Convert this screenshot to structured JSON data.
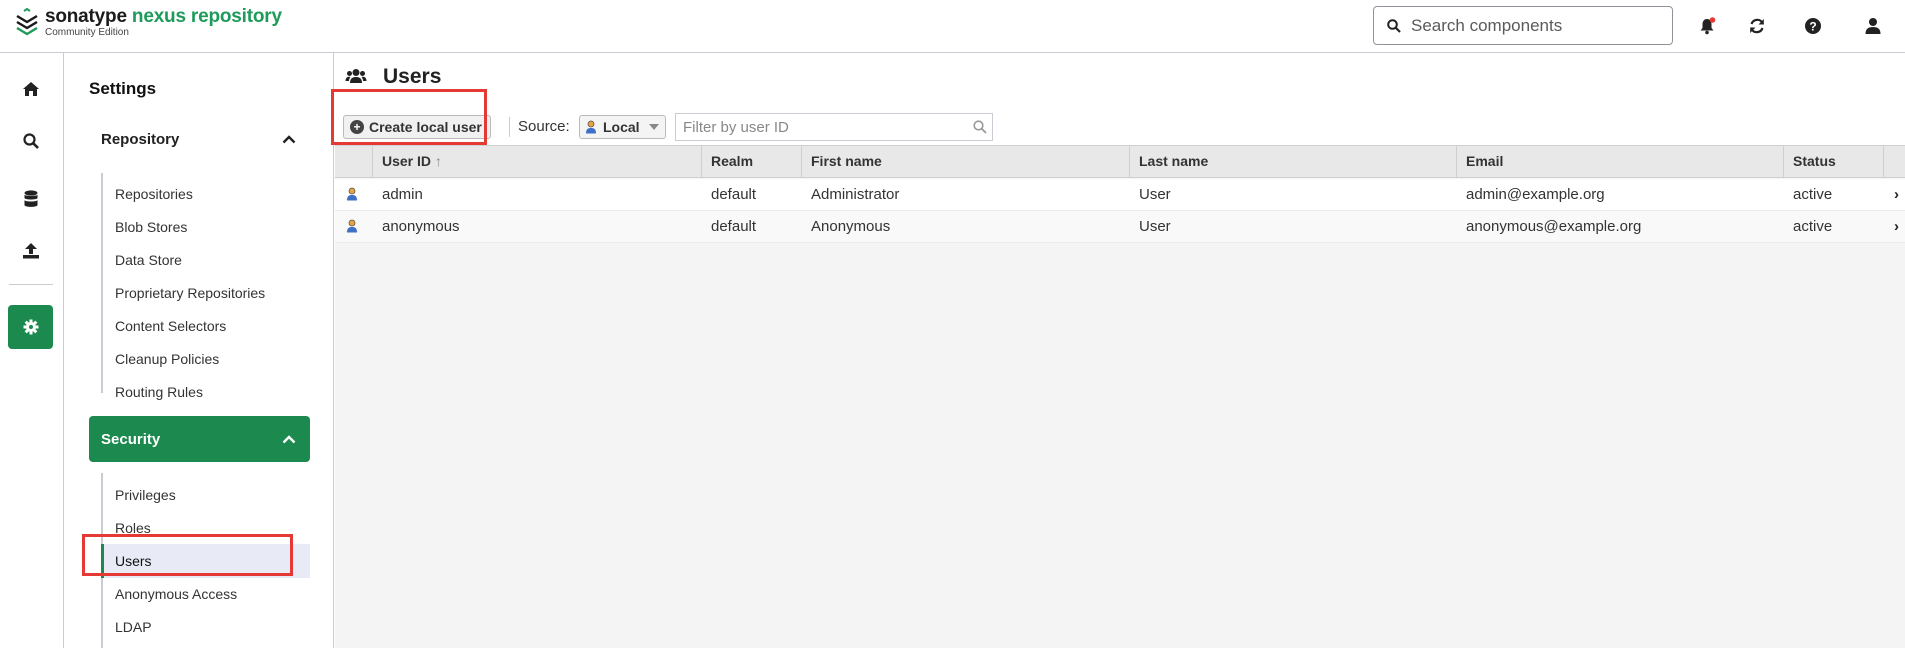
{
  "brand": {
    "name_part1": "sonatype",
    "name_part2": "nexus repository",
    "edition": "Community Edition"
  },
  "header": {
    "search_placeholder": "Search components"
  },
  "nav": {
    "title": "Settings",
    "repository_group": {
      "label": "Repository",
      "items": [
        "Repositories",
        "Blob Stores",
        "Data Store",
        "Proprietary Repositories",
        "Content Selectors",
        "Cleanup Policies",
        "Routing Rules"
      ]
    },
    "security_group": {
      "label": "Security",
      "items": [
        "Privileges",
        "Roles",
        "Users",
        "Anonymous Access",
        "LDAP"
      ]
    }
  },
  "page": {
    "title": "Users",
    "create_button": "Create local user",
    "source_label": "Source:",
    "source_value": "Local",
    "filter_placeholder": "Filter by user ID"
  },
  "table": {
    "columns": [
      "User ID",
      "Realm",
      "First name",
      "Last name",
      "Email",
      "Status"
    ],
    "sort_indicator": "↑",
    "rows": [
      {
        "user_id": "admin",
        "realm": "default",
        "first_name": "Administrator",
        "last_name": "User",
        "email": "admin@example.org",
        "status": "active"
      },
      {
        "user_id": "anonymous",
        "realm": "default",
        "first_name": "Anonymous",
        "last_name": "User",
        "email": "anonymous@example.org",
        "status": "active"
      }
    ]
  },
  "colors": {
    "brand_green": "#1c8a4f",
    "highlight_red": "#e53935",
    "selected_bg": "#e8eaf5"
  }
}
